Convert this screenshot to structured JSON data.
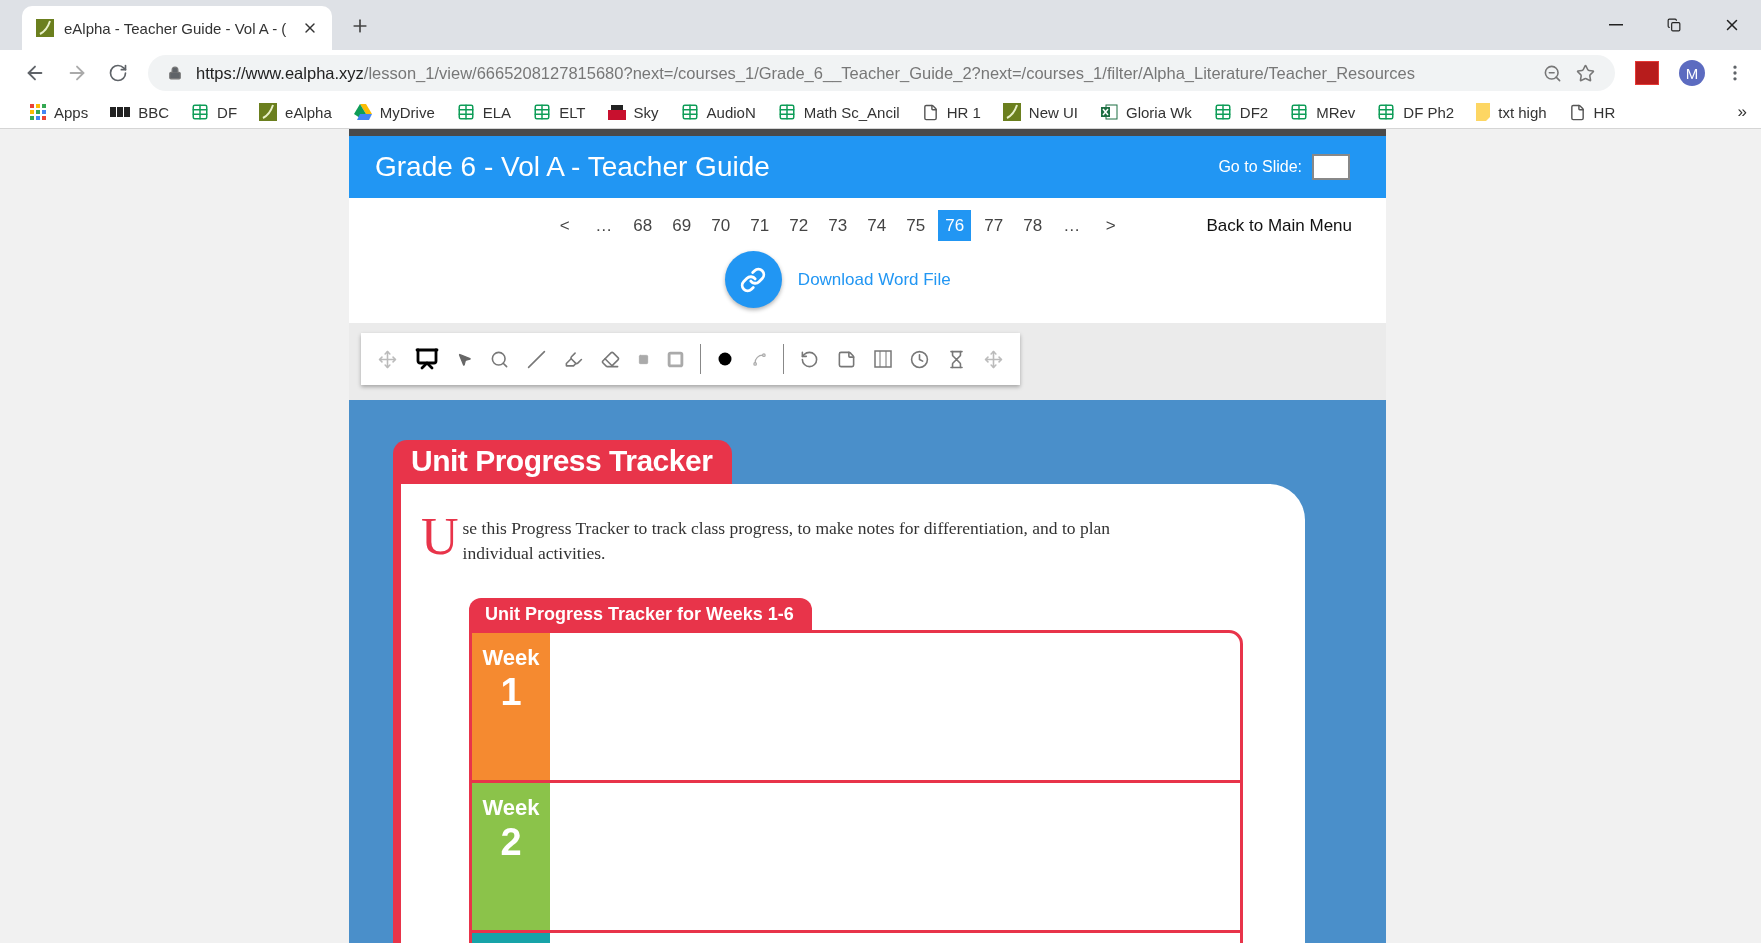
{
  "browser": {
    "tabs": [
      {
        "title": "eAlpha - Teacher Guide - Vol A - (",
        "selected": true
      }
    ],
    "address": {
      "host": "https://www.ealpha.xyz",
      "path": "/lesson_1/view/6665208127815680?next=/courses_1/Grade_6__Teacher_Guide_2?next=/courses_1/filter/Alpha_Literature/Teacher_Resources"
    },
    "profile_initial": "M",
    "bookmarks": [
      {
        "kind": "apps",
        "label": "Apps"
      },
      {
        "kind": "bbc",
        "label": "BBC"
      },
      {
        "kind": "sheet",
        "label": "DF"
      },
      {
        "kind": "ealpha",
        "label": "eAlpha"
      },
      {
        "kind": "drive",
        "label": "MyDrive"
      },
      {
        "kind": "sheet",
        "label": "ELA"
      },
      {
        "kind": "sheet",
        "label": "ELT"
      },
      {
        "kind": "sky",
        "label": "Sky"
      },
      {
        "kind": "sheet",
        "label": "AudioN"
      },
      {
        "kind": "sheet",
        "label": "Math Sc_Ancil"
      },
      {
        "kind": "file",
        "label": "HR 1"
      },
      {
        "kind": "ealpha",
        "label": "New UI"
      },
      {
        "kind": "excel",
        "label": "Gloria Wk"
      },
      {
        "kind": "sheet",
        "label": "DF2"
      },
      {
        "kind": "sheet",
        "label": "MRev"
      },
      {
        "kind": "sheet",
        "label": "DF Ph2"
      },
      {
        "kind": "note",
        "label": "txt high"
      },
      {
        "kind": "file",
        "label": "HR"
      }
    ],
    "overflow": "»"
  },
  "header": {
    "title": "Grade 6 - Vol A - Teacher Guide",
    "goto_label": "Go to Slide:"
  },
  "pager": [
    {
      "label": "<",
      "selected": false
    },
    {
      "label": "…",
      "selected": false
    },
    {
      "label": "68",
      "selected": false
    },
    {
      "label": "69",
      "selected": false
    },
    {
      "label": "70",
      "selected": false
    },
    {
      "label": "71",
      "selected": false
    },
    {
      "label": "72",
      "selected": false
    },
    {
      "label": "73",
      "selected": false
    },
    {
      "label": "74",
      "selected": false
    },
    {
      "label": "75",
      "selected": false
    },
    {
      "label": "76",
      "selected": true
    },
    {
      "label": "77",
      "selected": false
    },
    {
      "label": "78",
      "selected": false
    },
    {
      "label": "…",
      "selected": false
    },
    {
      "label": ">",
      "selected": false
    }
  ],
  "back_link": "Back to Main Menu",
  "download_link": "Download Word File",
  "tools": [
    {
      "kind": "move",
      "selected": false
    },
    {
      "kind": "presenter",
      "selected": true
    },
    {
      "kind": "pointer",
      "selected": false
    },
    {
      "kind": "zoom",
      "selected": false
    },
    {
      "kind": "pen",
      "selected": false
    },
    {
      "kind": "highlighter",
      "selected": false
    },
    {
      "kind": "eraser",
      "selected": false
    },
    {
      "kind": "square",
      "selected": false
    },
    {
      "kind": "frame",
      "selected": false
    },
    {
      "kind": "divider"
    },
    {
      "kind": "dot",
      "selected": false
    },
    {
      "kind": "curve",
      "selected": false
    },
    {
      "kind": "divider"
    },
    {
      "kind": "undo",
      "selected": false
    },
    {
      "kind": "note",
      "selected": false
    },
    {
      "kind": "board",
      "selected": false
    },
    {
      "kind": "clock",
      "selected": false
    },
    {
      "kind": "hourglass",
      "selected": false
    },
    {
      "kind": "move",
      "selected": false
    }
  ],
  "slide": {
    "title": "Unit Progress Tracker",
    "drop_cap": "U",
    "intro": "se this Progress Tracker to track class progress, to make notes for differentiation, and to plan individual activities.",
    "tracker_title": "Unit Progress Tracker for Weeks 1-6",
    "weeks": [
      {
        "label": "Week",
        "number": "1",
        "color": "#f58a30"
      },
      {
        "label": "Week",
        "number": "2",
        "color": "#8bc34a"
      },
      {
        "color": "#17a3a8"
      }
    ]
  }
}
